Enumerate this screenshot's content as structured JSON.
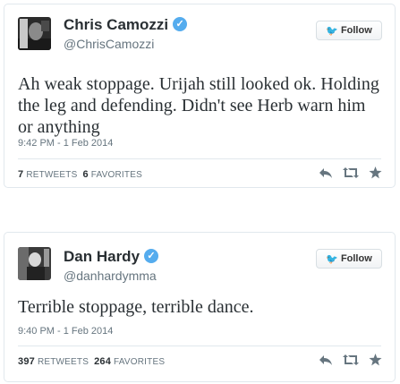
{
  "tweets": [
    {
      "display_name": "Chris Camozzi",
      "handle": "@ChrisCamozzi",
      "follow_label": "Follow",
      "text": "Ah weak stoppage. Urijah still looked ok. Holding the leg and defending. Didn't see Herb warn him or anything",
      "timestamp": "9:42 PM - 1 Feb 2014",
      "retweets_count": "7",
      "retweets_label": "RETWEETS",
      "favorites_count": "6",
      "favorites_label": "FAVORITES"
    },
    {
      "display_name": "Dan Hardy",
      "handle": "@danhardymma",
      "follow_label": "Follow",
      "text": "Terrible stoppage, terrible dance.",
      "timestamp": "9:40 PM - 1 Feb 2014",
      "retweets_count": "397",
      "retweets_label": "RETWEETS",
      "favorites_count": "264",
      "favorites_label": "FAVORITES"
    }
  ],
  "icons": {
    "verified": "verified-badge-icon",
    "follow_bird": "twitter-bird-icon",
    "reply": "reply-icon",
    "retweet": "retweet-icon",
    "favorite": "star-icon"
  },
  "colors": {
    "accent": "#55acee",
    "text": "#292f33",
    "muted": "#66757f",
    "border": "#e1e8ed"
  }
}
